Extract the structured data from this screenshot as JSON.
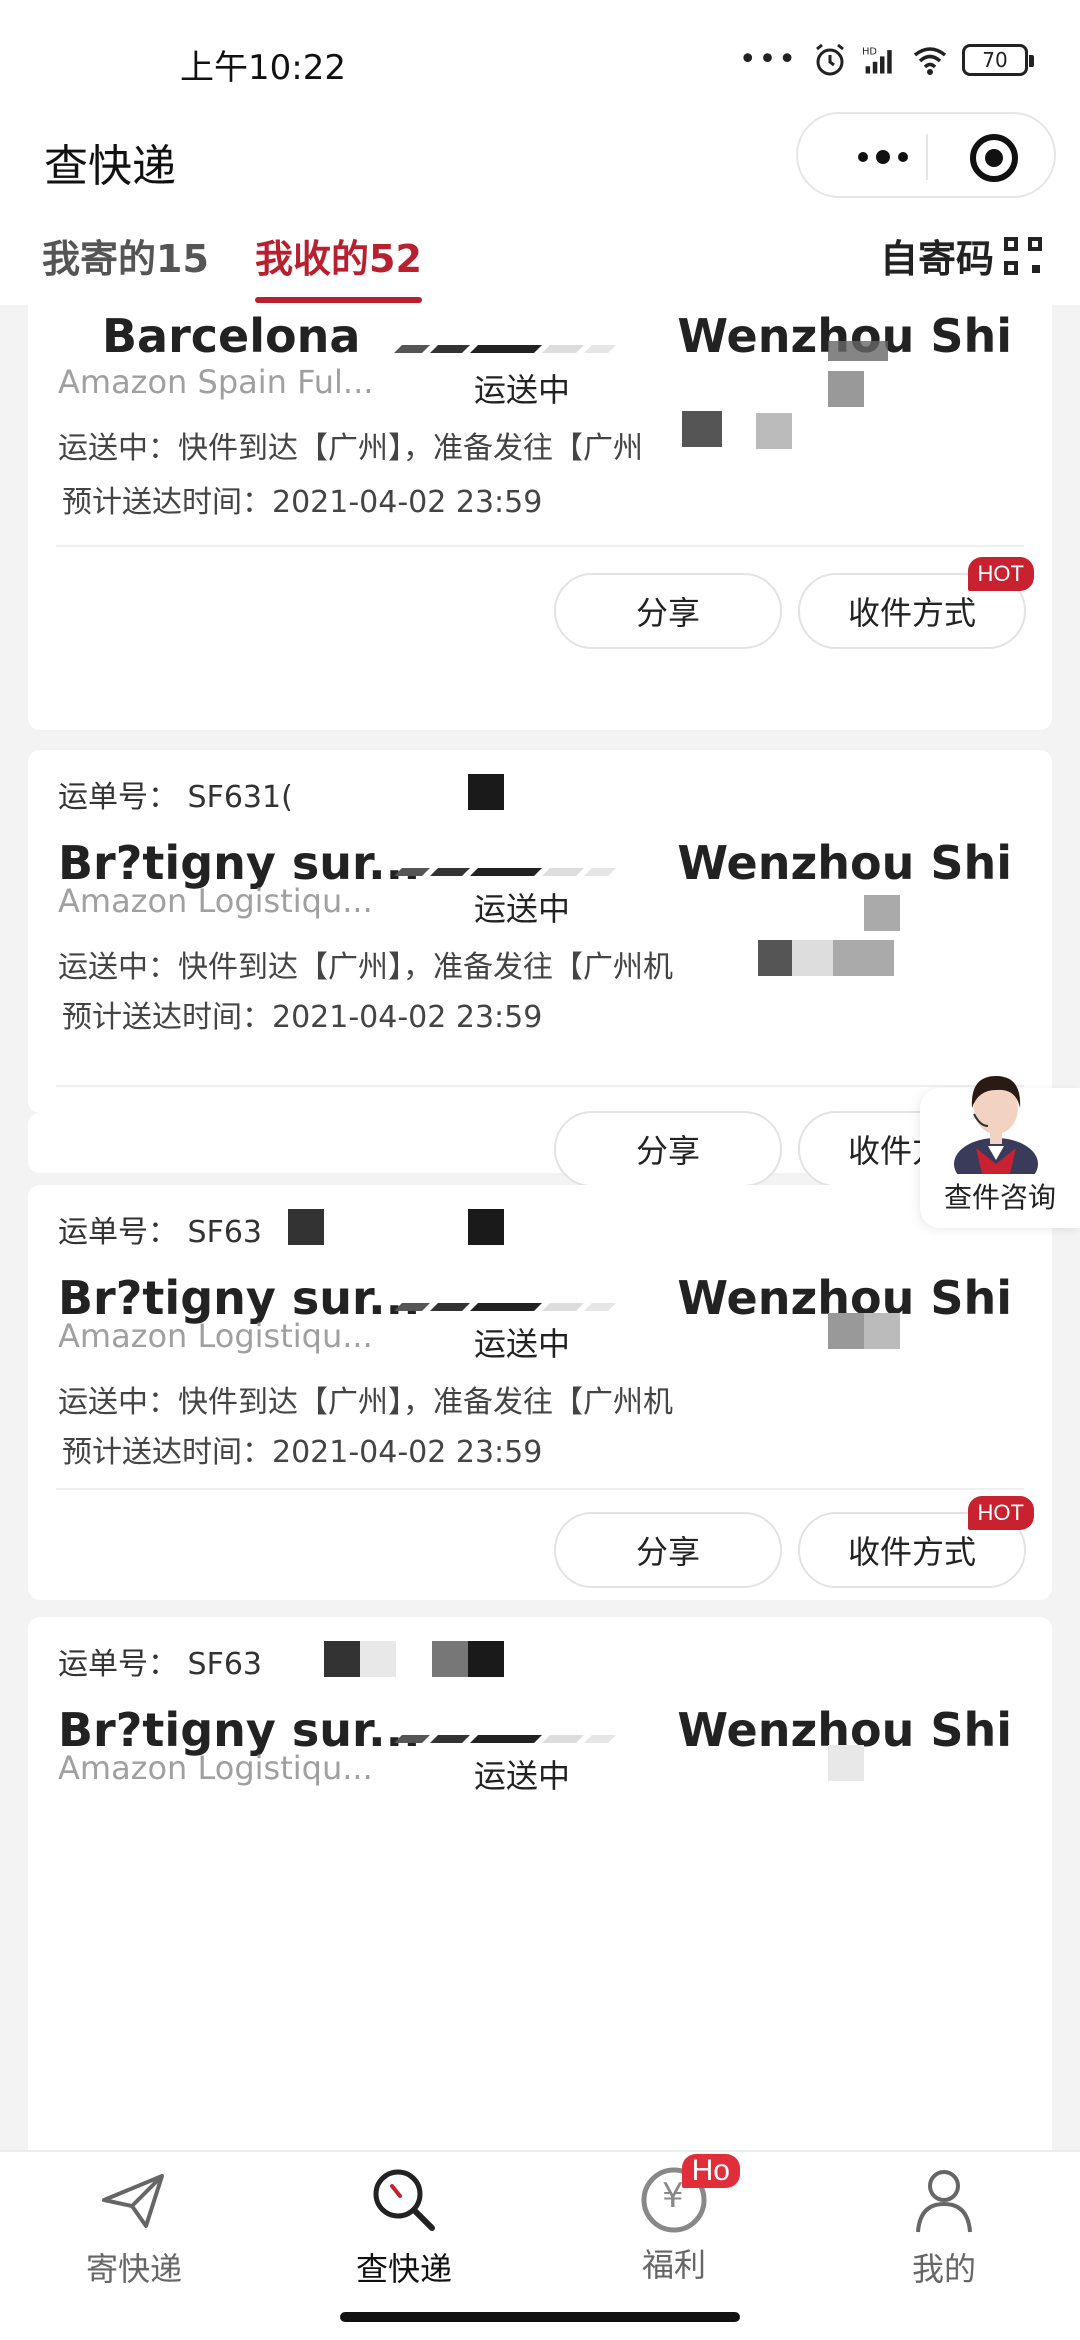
{
  "status_bar": {
    "time": "上午10:22",
    "battery": "70",
    "dots": "•••",
    "network_tag": "HD"
  },
  "header": {
    "title": "查快递"
  },
  "tabs": {
    "sent": "我寄的15",
    "received": "我收的52",
    "self_code": "自寄码"
  },
  "cards": [
    {
      "waybill": "",
      "from_city": "Barcelona",
      "from_warehouse": "Amazon Spain Ful...",
      "to_city": "Wenzhou Shi",
      "status": "运送中",
      "route": "运送中：快件到达【广州】，准备发往【广州",
      "eta": "预计送达时间：2021-04-02 23:59",
      "share": "分享",
      "receive": "收件方式",
      "hot": "HOT"
    },
    {
      "waybill": "运单号：  SF631(",
      "from_city": "Br?tigny sur...",
      "from_warehouse": "Amazon Logistiqu...",
      "to_city": "Wenzhou Shi",
      "status": "运送中",
      "route": "运送中：快件到达【广州】，准备发往【广州机",
      "eta": "预计送达时间：2021-04-02 23:59",
      "share": "分享",
      "receive": "收件方式",
      "hot": ""
    },
    {
      "waybill": "运单号：  SF63",
      "from_city": "Br?tigny sur...",
      "from_warehouse": "Amazon Logistiqu...",
      "to_city": "Wenzhou Shi",
      "status": "运送中",
      "route": "运送中：快件到达【广州】，准备发往【广州机",
      "eta": "预计送达时间：2021-04-02 23:59",
      "share": "分享",
      "receive": "收件方式",
      "hot": "HOT"
    },
    {
      "waybill": "运单号：  SF63",
      "from_city": "Br?tigny sur...",
      "from_warehouse": "Amazon Logistiqu...",
      "to_city": "Wenzhou Shi",
      "status": "运送中"
    }
  ],
  "float_help": {
    "label": "查件咨询"
  },
  "bottom_nav": {
    "send": "寄快递",
    "query": "查快递",
    "welfare": "福利",
    "welfare_badge": "Ho",
    "welfare_symbol": "¥",
    "me": "我的"
  },
  "colors": {
    "accent": "#b8202f",
    "badge": "#c8212f"
  }
}
